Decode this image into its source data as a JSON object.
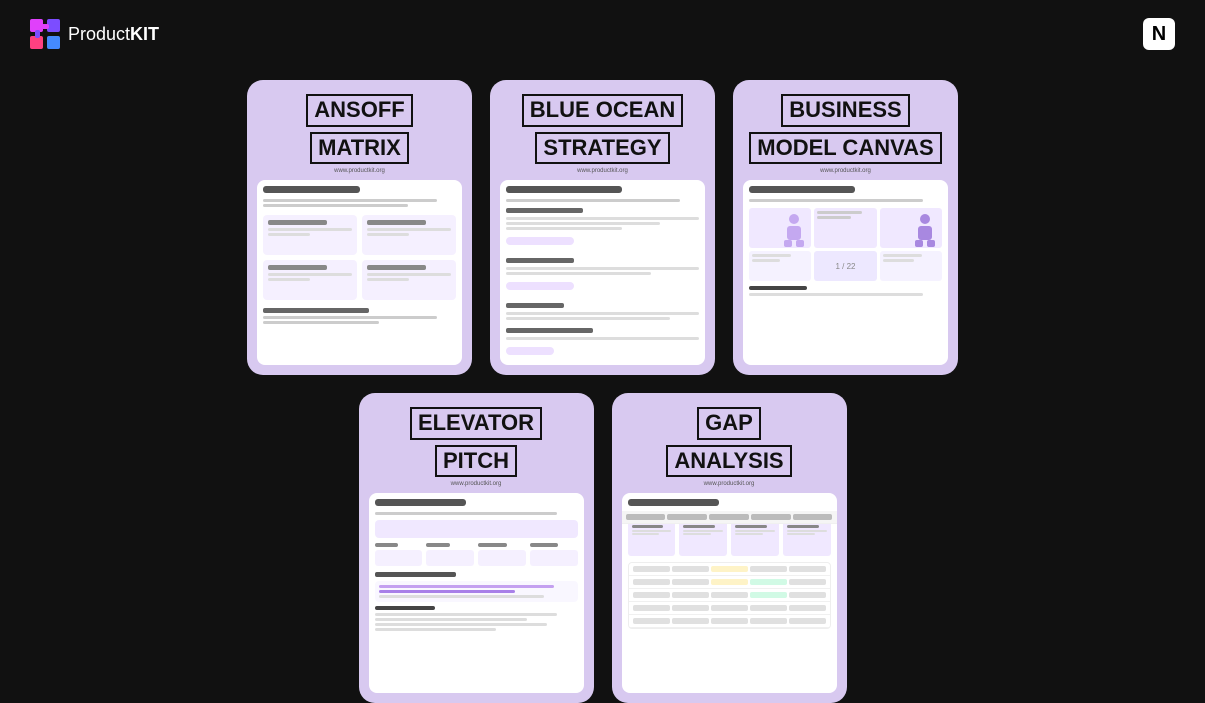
{
  "header": {
    "logo_text_normal": "Product",
    "logo_text_bold": "KIT",
    "notion_label": "N"
  },
  "cards": {
    "row1": [
      {
        "id": "ansoff-matrix",
        "title_line1": "ANSOFF",
        "title_line2": "MATRIX",
        "url": "www.productkit.org",
        "aria": "Ansoff Matrix card"
      },
      {
        "id": "blue-ocean-strategy",
        "title_line1": "BLUE OCEAN",
        "title_line2": "STRATEGY",
        "url": "www.productkit.org",
        "aria": "Blue Ocean Strategy card"
      },
      {
        "id": "business-model-canvas",
        "title_line1": "BUSINESS",
        "title_line2": "MODEL CANVAS",
        "url": "www.productkit.org",
        "aria": "Business Model Canvas card"
      }
    ],
    "row2": [
      {
        "id": "elevator-pitch",
        "title_line1": "ELEVATOR",
        "title_line2": "PITCH",
        "url": "www.productkit.org",
        "aria": "Elevator Pitch card"
      },
      {
        "id": "gap-analysis",
        "title_line1": "GAP",
        "title_line2": "ANALYSIS",
        "url": "www.productkit.org",
        "aria": "Gap Analysis card"
      }
    ]
  }
}
